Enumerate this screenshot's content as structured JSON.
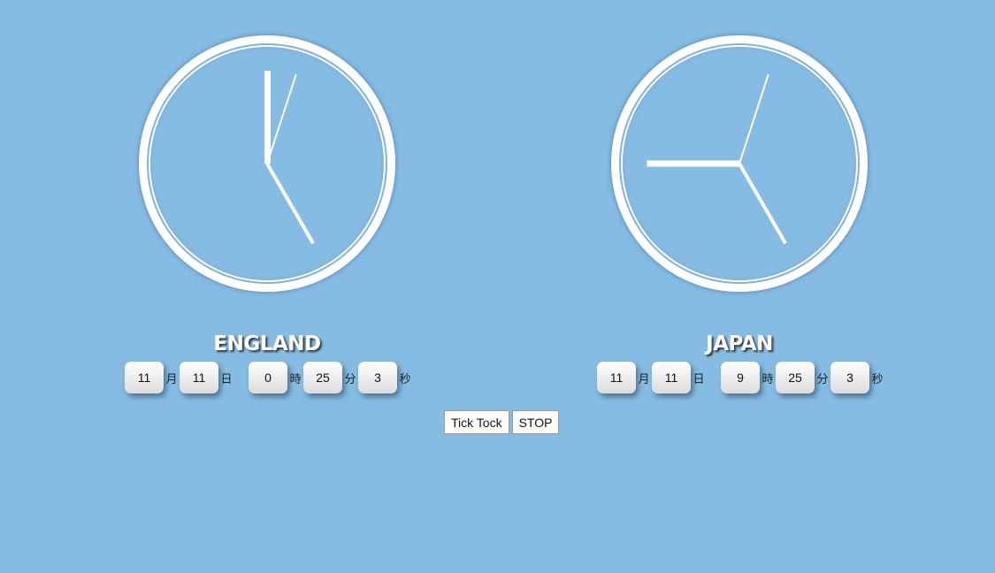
{
  "clocks": [
    {
      "country": "ENGLAND",
      "month": "11",
      "month_unit": "月",
      "day": "11",
      "day_unit": "日",
      "hour": "0",
      "hour_unit": "時",
      "minute": "25",
      "minute_unit": "分",
      "second": "3",
      "second_unit": "秒"
    },
    {
      "country": "JAPAN",
      "month": "11",
      "month_unit": "月",
      "day": "11",
      "day_unit": "日",
      "hour": "9",
      "hour_unit": "時",
      "minute": "25",
      "minute_unit": "分",
      "second": "3",
      "second_unit": "秒"
    }
  ],
  "controls": {
    "tick_label": "Tick Tock",
    "stop_label": "STOP"
  },
  "colors": {
    "background": "#86bce3",
    "clock": "#ffffff"
  }
}
